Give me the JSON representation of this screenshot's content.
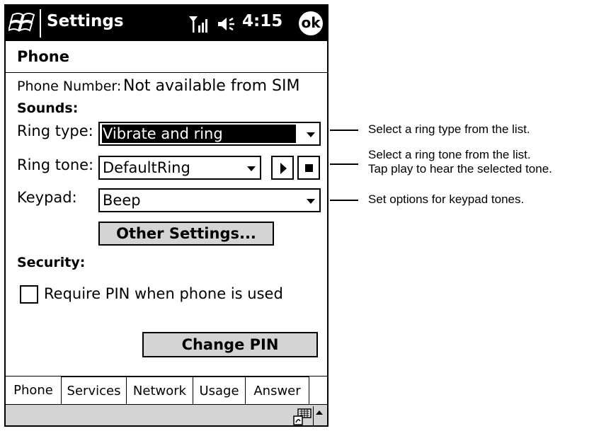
{
  "title_bar": {
    "title": "Settings",
    "time": "4:15",
    "ok_label": "ok"
  },
  "page": {
    "title": "Phone",
    "phone_number_label": "Phone Number:",
    "phone_number_value": "Not available from SIM",
    "sounds_heading": "Sounds:",
    "ring_type_label": "Ring type:",
    "ring_type_value": "Vibrate and ring",
    "ring_tone_label": "Ring tone:",
    "ring_tone_value": "DefaultRing",
    "keypad_label": "Keypad:",
    "keypad_value": "Beep",
    "other_settings_label": "Other Settings...",
    "security_heading": "Security:",
    "require_pin_label": "Require PIN when phone is used",
    "require_pin_checked": false,
    "change_pin_label": "Change PIN"
  },
  "tabs": [
    {
      "label": "Phone",
      "active": true
    },
    {
      "label": "Services",
      "active": false
    },
    {
      "label": "Network",
      "active": false
    },
    {
      "label": "Usage",
      "active": false
    },
    {
      "label": "Answer",
      "active": false
    }
  ],
  "callouts": {
    "ring_type": "Select a ring type from the list.",
    "ring_tone_line1": "Select a ring tone from the list.",
    "ring_tone_line2": "Tap play to hear the selected tone.",
    "keypad": "Set options for keypad tones."
  },
  "icons": {
    "start": "windows-flag-icon",
    "signal": "signal-strength-icon",
    "speaker": "speaker-icon",
    "keyboard": "keyboard-icon",
    "sip_menu": "chevron-up-icon"
  }
}
